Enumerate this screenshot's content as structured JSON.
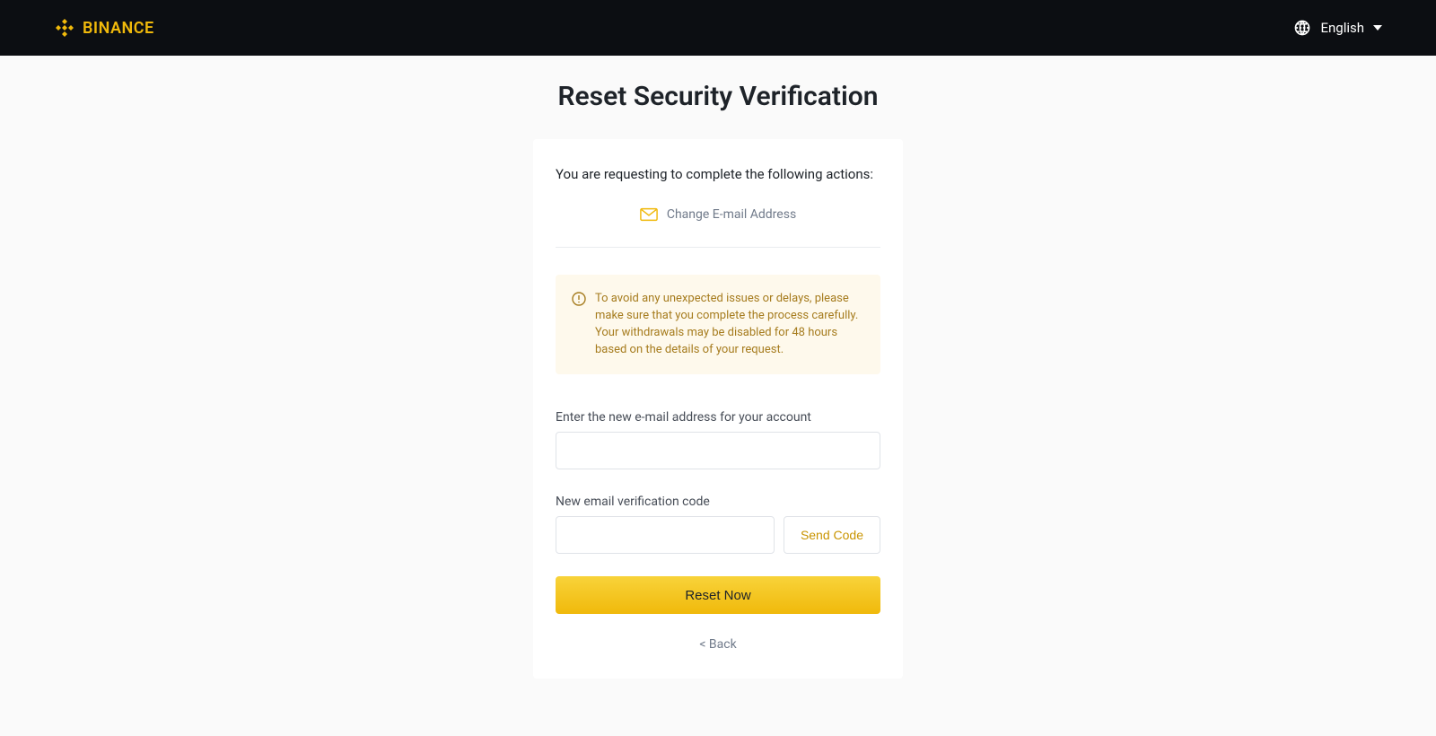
{
  "header": {
    "brand": "BINANCE",
    "language": "English"
  },
  "page": {
    "title": "Reset Security Verification"
  },
  "card": {
    "request_text": "You are requesting to complete the following actions:",
    "action_label": "Change E-mail Address",
    "warning_text": "To avoid any unexpected issues or delays, please make sure that you complete the process carefully. Your withdrawals may be disabled for 48 hours based on the details of your request.",
    "email_label": "Enter the new e-mail address for your account",
    "code_label": "New email verification code",
    "send_code_label": "Send Code",
    "reset_label": "Reset Now",
    "back_label": "< Back"
  }
}
